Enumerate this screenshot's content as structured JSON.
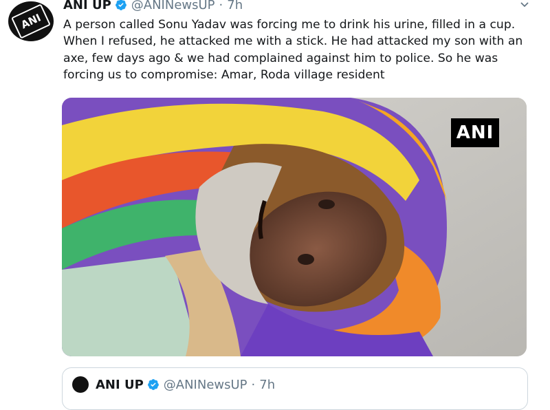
{
  "tweet": {
    "avatar_text": "ANI",
    "name": "ANI UP",
    "handle": "@ANINewsUP",
    "separator": "·",
    "time": "7h",
    "text": "A person called Sonu Yadav was forcing me to drink his urine, filled in a cup. When I refused, he attacked me with a stick. He had attacked my son with an axe, few days ago & we had complained against him to police. So he was forcing us to compromise: Amar, Roda village resident",
    "media_watermark": "ANI"
  },
  "quoted_tweet": {
    "name": "ANI UP",
    "handle": "@ANINewsUP",
    "separator": "·",
    "time": "7h"
  },
  "colors": {
    "text": "#14171a",
    "secondary": "#657786",
    "verified": "#1da1f2",
    "border": "#ccd6dd"
  },
  "icons": [
    "verified-badge-icon",
    "chevron-down-icon"
  ]
}
